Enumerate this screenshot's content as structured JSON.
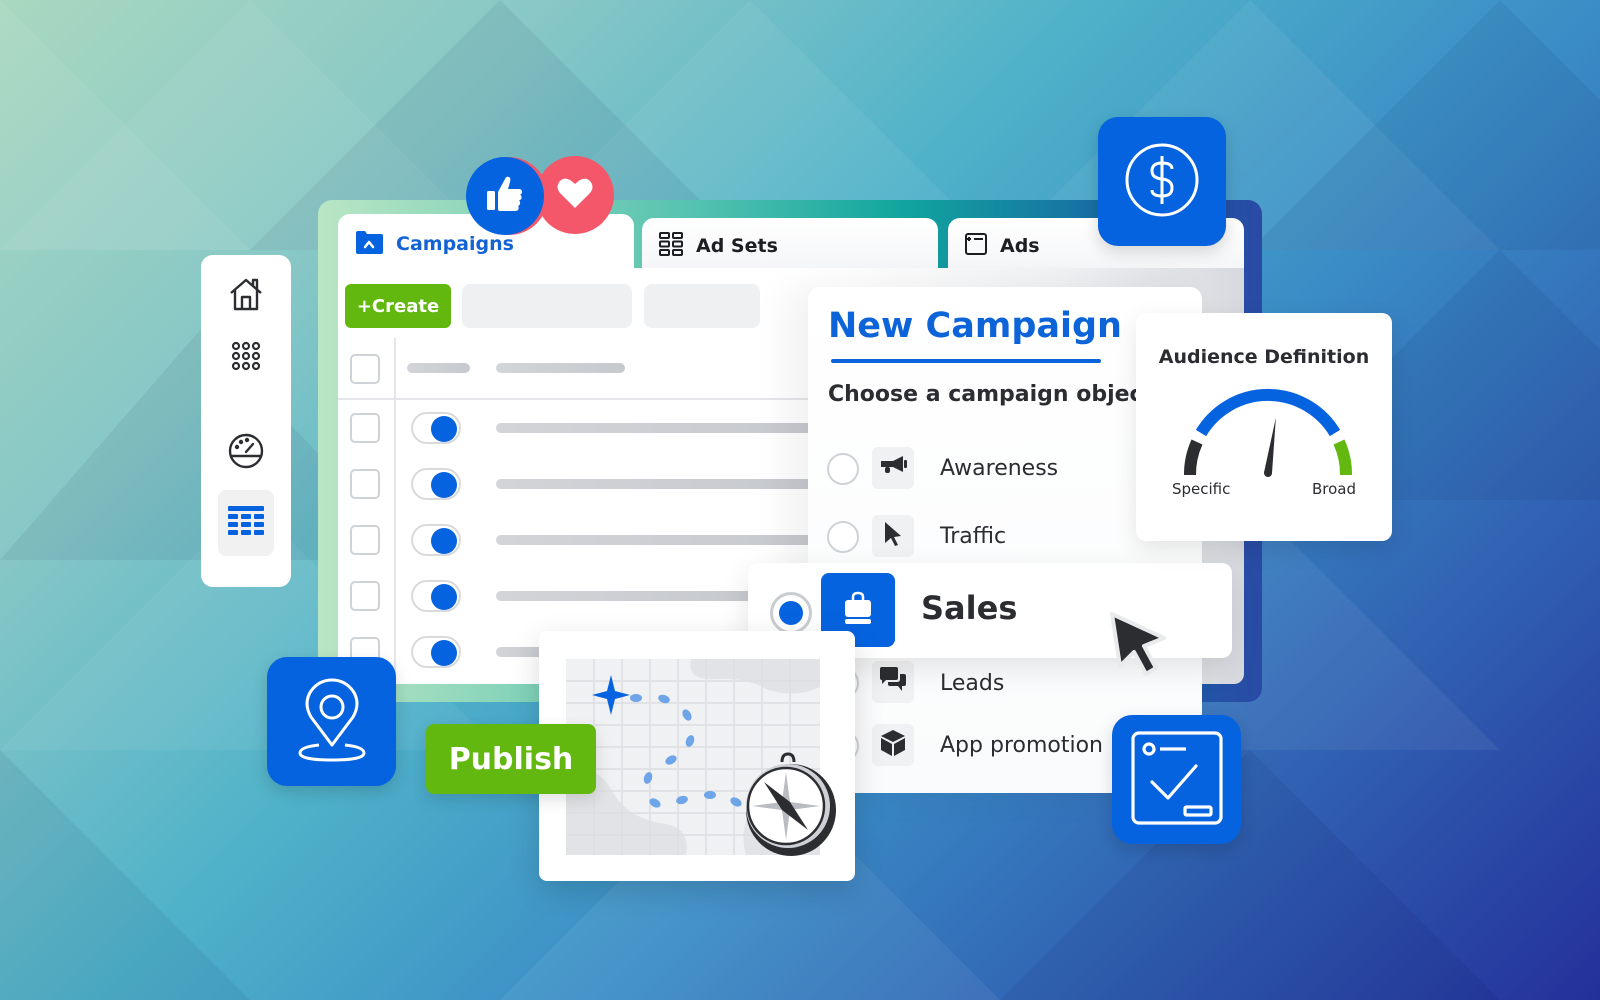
{
  "theme": {
    "accent_blue": "#0663e0",
    "accent_green": "#63b80f",
    "reaction_red": "#f5576a",
    "text_dark": "#2b2d31"
  },
  "tabs": [
    {
      "label": "Campaigns",
      "icon": "folder-icon",
      "active": true
    },
    {
      "label": "Ad Sets",
      "icon": "grid-icon",
      "active": false
    },
    {
      "label": "Ads",
      "icon": "window-icon",
      "active": false
    }
  ],
  "toolbar": {
    "create_label": "+Create"
  },
  "sidebar": {
    "items": [
      {
        "icon": "home-icon",
        "active": false
      },
      {
        "icon": "apps-grid-icon",
        "active": false
      },
      {
        "icon": "dashboard-gauge-icon",
        "active": false
      },
      {
        "icon": "table-icon",
        "active": true
      }
    ]
  },
  "table": {
    "rows": [
      {
        "checked": false,
        "enabled": true
      },
      {
        "checked": false,
        "enabled": true
      },
      {
        "checked": false,
        "enabled": true
      },
      {
        "checked": false,
        "enabled": true
      },
      {
        "checked": false,
        "enabled": true
      }
    ]
  },
  "new_campaign": {
    "title": "New Campaign",
    "subtitle": "Choose a campaign objecti",
    "objectives": [
      {
        "label": "Awareness",
        "icon": "megaphone-icon",
        "selected": false
      },
      {
        "label": "Traffic",
        "icon": "cursor-icon",
        "selected": false
      },
      {
        "label": "Sales",
        "icon": "shopping-bag-icon",
        "selected": true
      },
      {
        "label": "Leads",
        "icon": "chat-bubbles-icon",
        "selected": false
      },
      {
        "label": "App promotion",
        "icon": "cube-icon",
        "selected": false
      }
    ]
  },
  "audience": {
    "title": "Audience Definition",
    "min_label": "Specific",
    "max_label": "Broad",
    "needle_fraction": 0.6
  },
  "publish": {
    "label": "Publish"
  },
  "floating_icons": [
    "like-icon",
    "heart-icon",
    "dollar-icon",
    "location-pin-icon",
    "checklist-icon",
    "map-icon",
    "compass-icon"
  ]
}
